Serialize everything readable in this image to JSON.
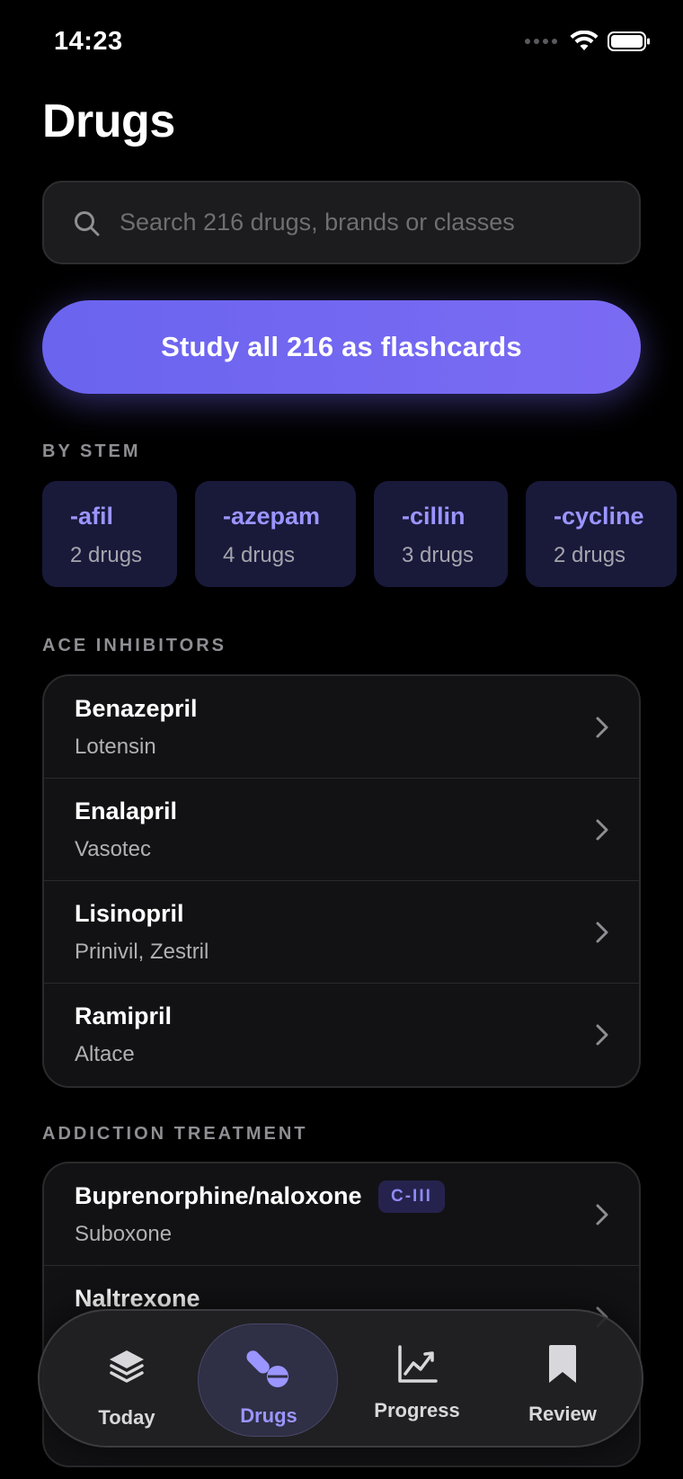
{
  "status": {
    "time": "14:23"
  },
  "page": {
    "title": "Drugs"
  },
  "search": {
    "placeholder": "Search 216 drugs, brands or classes",
    "value": ""
  },
  "cta": {
    "label": "Study all 216 as flashcards"
  },
  "stems_section": {
    "label": "BY STEM",
    "items": [
      {
        "name": "-afil",
        "count": "2 drugs"
      },
      {
        "name": "-azepam",
        "count": "4 drugs"
      },
      {
        "name": "-cillin",
        "count": "3 drugs"
      },
      {
        "name": "-cycline",
        "count": "2 drugs"
      }
    ]
  },
  "ace_section": {
    "label": "ACE INHIBITORS",
    "items": [
      {
        "name": "Benazepril",
        "brand": "Lotensin"
      },
      {
        "name": "Enalapril",
        "brand": "Vasotec"
      },
      {
        "name": "Lisinopril",
        "brand": "Prinivil, Zestril"
      },
      {
        "name": "Ramipril",
        "brand": "Altace"
      }
    ]
  },
  "addiction_section": {
    "label": "ADDICTION TREATMENT",
    "items": [
      {
        "name": "Buprenorphine/naloxone",
        "brand": "Suboxone",
        "badge": "C-III"
      },
      {
        "name": "Naltrexone",
        "brand": ""
      }
    ]
  },
  "tabbar": {
    "tabs": [
      {
        "label": "Today",
        "icon": "layers-icon"
      },
      {
        "label": "Drugs",
        "icon": "pills-icon",
        "active": true
      },
      {
        "label": "Progress",
        "icon": "chart-icon"
      },
      {
        "label": "Review",
        "icon": "bookmark-icon"
      }
    ]
  },
  "colors": {
    "accent": "#7b6bf3",
    "accent_text": "#9b95ff",
    "background": "#000000",
    "card": "#121214"
  }
}
